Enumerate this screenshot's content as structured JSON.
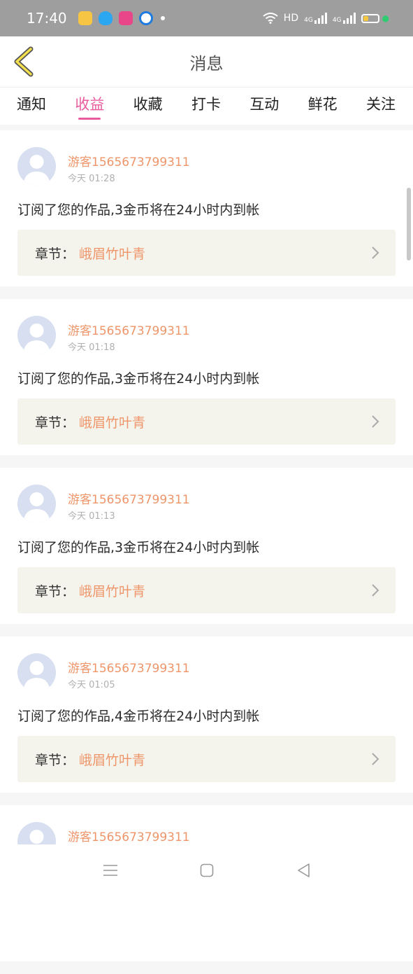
{
  "status": {
    "time": "17:40",
    "hd": "HD",
    "net1": "4G",
    "net2": "4G"
  },
  "header": {
    "title": "消息"
  },
  "tabs": [
    {
      "label": "通知",
      "active": false
    },
    {
      "label": "收益",
      "active": true
    },
    {
      "label": "收藏",
      "active": false
    },
    {
      "label": "打卡",
      "active": false
    },
    {
      "label": "互动",
      "active": false
    },
    {
      "label": "鲜花",
      "active": false
    },
    {
      "label": "关注",
      "active": false
    }
  ],
  "notifications": [
    {
      "user": "游客1565673799311",
      "time": "今天 01:28",
      "message": "订阅了您的作品,3金币将在24小时内到帐",
      "chapter_label": "章节：",
      "chapter_name": "峨眉竹叶青"
    },
    {
      "user": "游客1565673799311",
      "time": "今天 01:18",
      "message": "订阅了您的作品,3金币将在24小时内到帐",
      "chapter_label": "章节：",
      "chapter_name": "峨眉竹叶青"
    },
    {
      "user": "游客1565673799311",
      "time": "今天 01:13",
      "message": "订阅了您的作品,3金币将在24小时内到帐",
      "chapter_label": "章节：",
      "chapter_name": "峨眉竹叶青"
    },
    {
      "user": "游客1565673799311",
      "time": "今天 01:05",
      "message": "订阅了您的作品,4金币将在24小时内到帐",
      "chapter_label": "章节：",
      "chapter_name": "峨眉竹叶青"
    },
    {
      "user": "游客1565673799311",
      "time": "",
      "message": "",
      "chapter_label": "",
      "chapter_name": ""
    }
  ],
  "colors": {
    "accent": "#e85c9d",
    "username": "#ee956a",
    "statusbar": "#9e9e9e"
  },
  "icons": [
    "back-arrow-icon",
    "chevron-right-icon",
    "avatar-placeholder-icon",
    "menu-icon",
    "home-icon",
    "back-triangle-icon"
  ]
}
